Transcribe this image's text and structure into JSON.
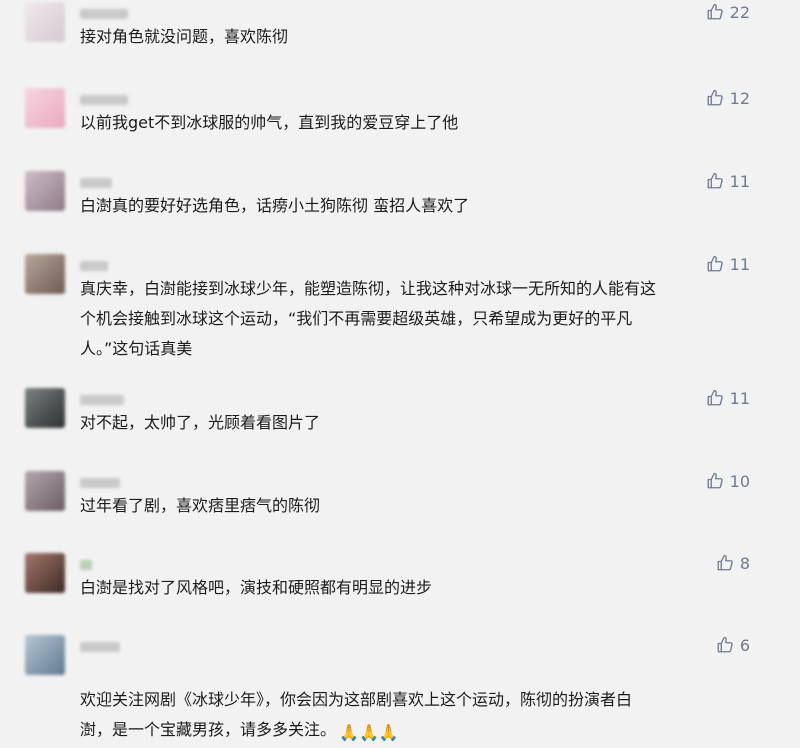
{
  "comments": [
    {
      "text": "接对角色就没问题，喜欢陈彻",
      "likes": "22",
      "avatar_color": "#e3d8de"
    },
    {
      "text": "以前我get不到冰球服的帅气，直到我的爱豆穿上了他",
      "likes": "12",
      "avatar_color": "#f3c8d6"
    },
    {
      "text": "白澍真的要好好选角色，话痨小土狗陈彻 蛮招人喜欢了",
      "likes": "11",
      "avatar_color": "#b9a8b3"
    },
    {
      "text": "真庆幸，白澍能接到冰球少年，能塑造陈彻，让我这种对冰球一无所知的人能有这\n个机会接触到冰球这个运动，“我们不再需要超级英雄，只希望成为更好的平凡\n人。”这句话真美",
      "likes": "11",
      "avatar_color": "#9c8a80"
    },
    {
      "text": "对不起，太帅了，光顾着看图片了",
      "likes": "11",
      "avatar_color": "#3f4546"
    },
    {
      "text": "过年看了剧，喜欢痞里痞气的陈彻",
      "likes": "10",
      "avatar_color": "#8c7f86"
    },
    {
      "text": "白澍是找对了风格吧，演技和硬照都有明显的进步",
      "likes": "8",
      "avatar_color": "#6b4a3e"
    },
    {
      "text": "欢迎关注网剧《冰球少年》，你会因为这部剧喜欢上这个运动，陈彻的扮演者白\n澍，是一个宝藏男孩，请多多关注。",
      "likes": "6",
      "avatar_color": "#7f9ab0",
      "emoji": "🙏🙏🙏"
    }
  ],
  "icons": {
    "like": "thumbs-up-icon",
    "emoji": "praying-hands-emoji"
  },
  "colors": {
    "like_text": "#6e7b94",
    "background": "#f2f2f2"
  }
}
